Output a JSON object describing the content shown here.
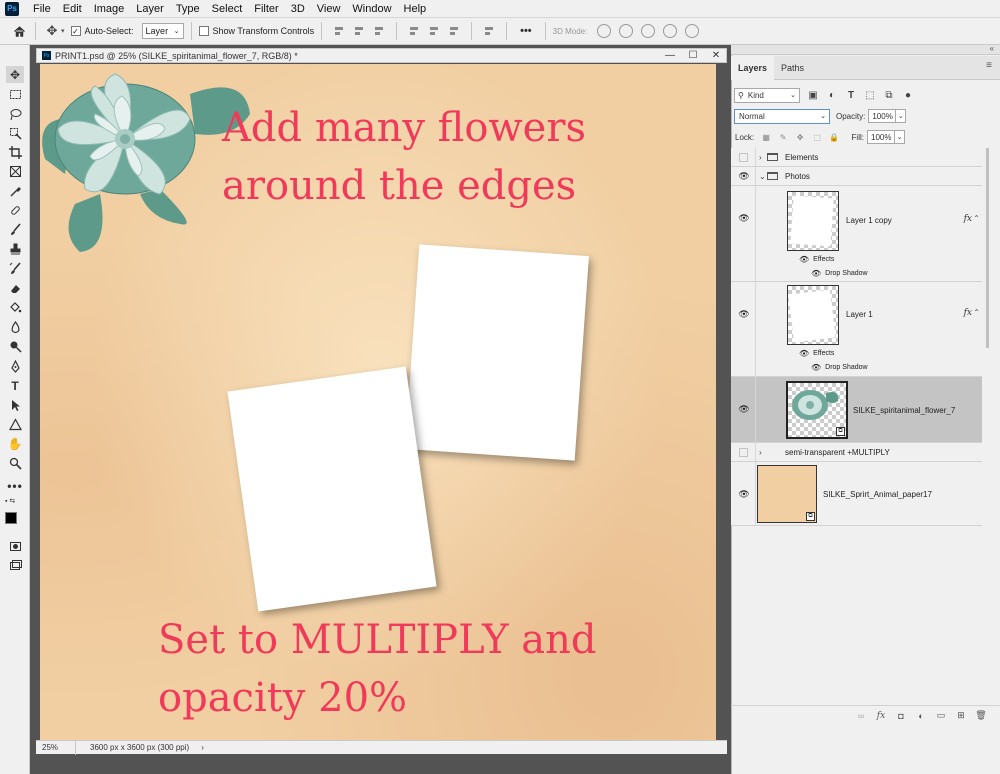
{
  "app": {
    "logo_text": "Ps"
  },
  "menu": [
    "File",
    "Edit",
    "Image",
    "Layer",
    "Type",
    "Select",
    "Filter",
    "3D",
    "View",
    "Window",
    "Help"
  ],
  "options_bar": {
    "auto_select_label": "Auto-Select:",
    "auto_select_checked": true,
    "auto_select_target": "Layer",
    "transform_label": "Show Transform Controls",
    "transform_checked": false,
    "mode_3d_label": "3D Mode:",
    "more_label": "•••"
  },
  "document": {
    "tab_title": "PRINT1.psd @ 25% (SILKE_spiritanimal_flower_7, RGB/8) *",
    "zoom": "25%",
    "dimensions": "3600 px x 3600 px (300 ppi)",
    "status_arrow": "›"
  },
  "canvas": {
    "note_top_line1": "Add many flowers",
    "note_top_line2": "around the edges",
    "note_bottom_line1": "Set to MULTIPLY and",
    "note_bottom_line2": "opacity 20%",
    "text_color": "#ef3a5a",
    "paper_color": "#f1cfa3"
  },
  "panel": {
    "tabs": [
      "Layers",
      "Paths"
    ],
    "active_tab": "Layers",
    "kind_filter": "Kind",
    "blend_mode": "Normal",
    "opacity_label": "Opacity:",
    "opacity_value": "100%",
    "lock_label": "Lock:",
    "fill_label": "Fill:",
    "fill_value": "100%",
    "layers": [
      {
        "name": "Elements",
        "type": "group",
        "visible": false,
        "expanded": false
      },
      {
        "name": "Photos",
        "type": "group",
        "visible": true,
        "expanded": true
      },
      {
        "name": "Layer 1 copy",
        "type": "layer",
        "visible": true,
        "fx": "fx",
        "effects_label": "Effects",
        "effect": "Drop Shadow"
      },
      {
        "name": "Layer 1",
        "type": "layer",
        "visible": true,
        "fx": "fx",
        "effects_label": "Effects",
        "effect": "Drop Shadow"
      },
      {
        "name": "SILKE_spiritanimal_flower_7",
        "type": "layer",
        "visible": true,
        "selected": true
      },
      {
        "name": "semi-transparent +MULTIPLY",
        "type": "group",
        "visible": false,
        "expanded": false
      },
      {
        "name": "SILKE_Sprirt_Animal_paper17",
        "type": "layer",
        "visible": true
      }
    ]
  }
}
